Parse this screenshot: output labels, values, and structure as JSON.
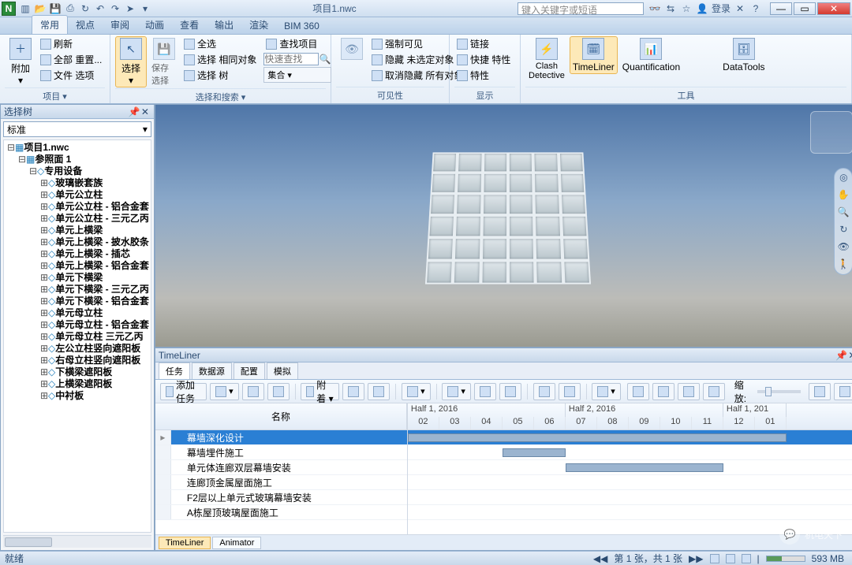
{
  "title": "项目1.nwc",
  "search_placeholder": "键入关键字或短语",
  "login": "登录",
  "ribbon_tabs": [
    "常用",
    "视点",
    "审阅",
    "动画",
    "查看",
    "输出",
    "渲染",
    "BIM 360"
  ],
  "ribbon": {
    "g1": {
      "label": "项目 ▾",
      "big": "附加",
      "items": [
        "刷新",
        "全部 重置...",
        "文件 选项"
      ]
    },
    "g2": {
      "label": "选择和搜索 ▾",
      "big": "选择",
      "save": "保存选择",
      "items": [
        "全选",
        "选择 相同对象",
        "选择 树"
      ],
      "items2": [
        "查找项目"
      ],
      "quick": "快速查找",
      "sets": "集合 ▾"
    },
    "g3": {
      "label": "可见性",
      "items": [
        "强制可见",
        "隐藏 未选定对象",
        "取消隐藏 所有对象"
      ]
    },
    "g4": {
      "label": "显示",
      "items": [
        "链接",
        "快捷 特性",
        "特性"
      ]
    },
    "g5": {
      "label": "工具",
      "clash": "Clash\nDetective",
      "tl": "TimeLiner",
      "quant": "Quantification",
      "dt": "DataTools"
    }
  },
  "panel": {
    "title": "选择树",
    "combo": "标准",
    "root": "项目1.nwc",
    "level1": "参照面 1",
    "level2": "专用设备",
    "items": [
      "玻璃嵌套族",
      "单元公立柱",
      "单元公立柱 - 铝合金套",
      "单元公立柱 - 三元乙丙",
      "单元上横梁",
      "单元上横梁 - 披水胶条",
      "单元上横梁 - 插芯",
      "单元上横梁 - 铝合金套",
      "单元下横梁",
      "单元下横梁 - 三元乙丙",
      "单元下横梁 - 铝合金套",
      "单元母立柱",
      "单元母立柱 - 铝合金套",
      "单元母立柱 三元乙丙",
      "左公立柱竖向遮阳板",
      "右母立柱竖向遮阳板",
      "下横梁遮阳板",
      "上横梁遮阳板",
      "中衬板"
    ]
  },
  "timeliner": {
    "title": "TimeLiner",
    "tabs": [
      "任务",
      "数据源",
      "配置",
      "模拟"
    ],
    "add": "添加任务",
    "attach": "附着 ▾",
    "zoom": "缩放:",
    "col_name": "名称",
    "halves": [
      "Half 1, 2016",
      "Half 2, 2016",
      "Half 1, 201"
    ],
    "months": [
      "02",
      "03",
      "04",
      "05",
      "06",
      "07",
      "08",
      "09",
      "10",
      "11",
      "12",
      "01"
    ],
    "tasks": [
      {
        "name": "幕墙深化设计",
        "sel": true,
        "bar": [
          0,
          480
        ]
      },
      {
        "name": "幕墙埋件施工",
        "bar": [
          120,
          200
        ]
      },
      {
        "name": "单元体连廊双层幕墙安装",
        "bar": [
          200,
          400
        ]
      },
      {
        "name": "连廊顶金属屋面施工"
      },
      {
        "name": "F2层以上单元式玻璃幕墙安装"
      },
      {
        "name": "A栋屋顶玻璃屋面施工"
      }
    ],
    "bottom_tabs": [
      "TimeLiner",
      "Animator"
    ]
  },
  "status": {
    "ready": "就绪",
    "sheet": "第 1 张，共 1 张",
    "mem": "593 MB"
  },
  "watermark": "机电天下"
}
